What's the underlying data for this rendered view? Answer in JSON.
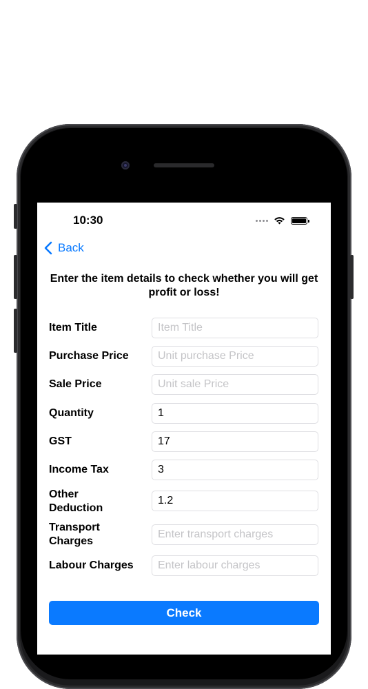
{
  "status_bar": {
    "time": "10:30"
  },
  "nav": {
    "back_label": "Back"
  },
  "heading": "Enter the item details to check whether you will get profit or loss!",
  "form": {
    "item_title": {
      "label": "Item Title",
      "value": "",
      "placeholder": "Item Title"
    },
    "purchase_price": {
      "label": "Purchase Price",
      "value": "",
      "placeholder": "Unit purchase Price"
    },
    "sale_price": {
      "label": "Sale Price",
      "value": "",
      "placeholder": "Unit sale Price"
    },
    "quantity": {
      "label": "Quantity",
      "value": "1",
      "placeholder": ""
    },
    "gst": {
      "label": "GST",
      "value": "17",
      "placeholder": ""
    },
    "income_tax": {
      "label": "Income Tax",
      "value": "3",
      "placeholder": ""
    },
    "other_deduction": {
      "label_line1": "Other",
      "label_line2": "Deduction",
      "value": "1.2",
      "placeholder": ""
    },
    "transport_charges": {
      "label_line1": "Transport",
      "label_line2": "Charges",
      "value": "",
      "placeholder": "Enter transport charges"
    },
    "labour_charges": {
      "label": "Labour Charges",
      "value": "",
      "placeholder": "Enter labour charges"
    }
  },
  "check_button": {
    "label": "Check"
  },
  "colors": {
    "accent": "#0a7aff",
    "field_border": "#dedee2",
    "placeholder": "#c4c4c7"
  },
  "icons": {
    "back": "chevron-left-icon",
    "wifi": "wifi-icon",
    "battery": "battery-icon"
  }
}
